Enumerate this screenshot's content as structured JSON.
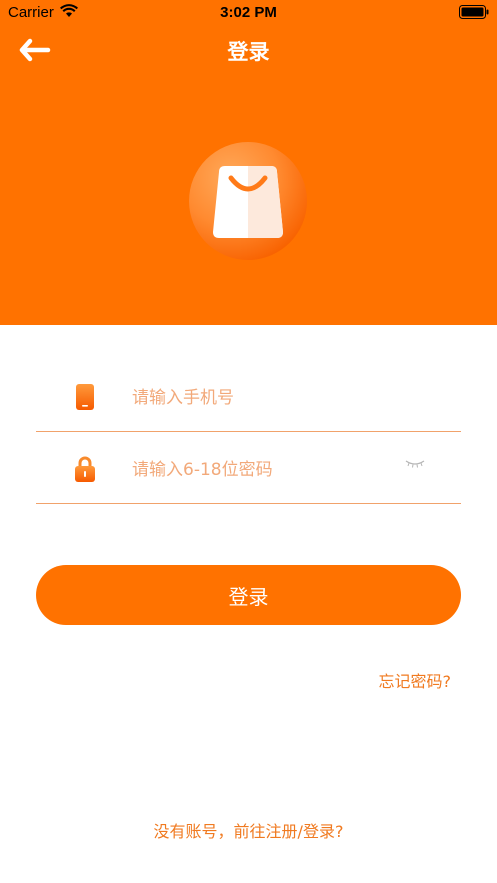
{
  "status_bar": {
    "carrier": "Carrier",
    "time": "3:02 PM"
  },
  "nav": {
    "title": "登录"
  },
  "form": {
    "phone_placeholder": "请输入手机号",
    "password_placeholder": "请输入6-18位密码"
  },
  "actions": {
    "login_label": "登录",
    "forgot_label": "忘记密码?",
    "register_label": "没有账号，前往注册/登录?"
  },
  "icons": {
    "back": "back-arrow-icon",
    "logo": "shopping-bag-icon",
    "phone": "phone-icon",
    "lock": "lock-icon",
    "eye": "eye-closed-icon"
  },
  "colors": {
    "primary": "#ff7200",
    "link": "#f07a20",
    "placeholder": "#f2a97a",
    "divider": "#f1a26b"
  }
}
